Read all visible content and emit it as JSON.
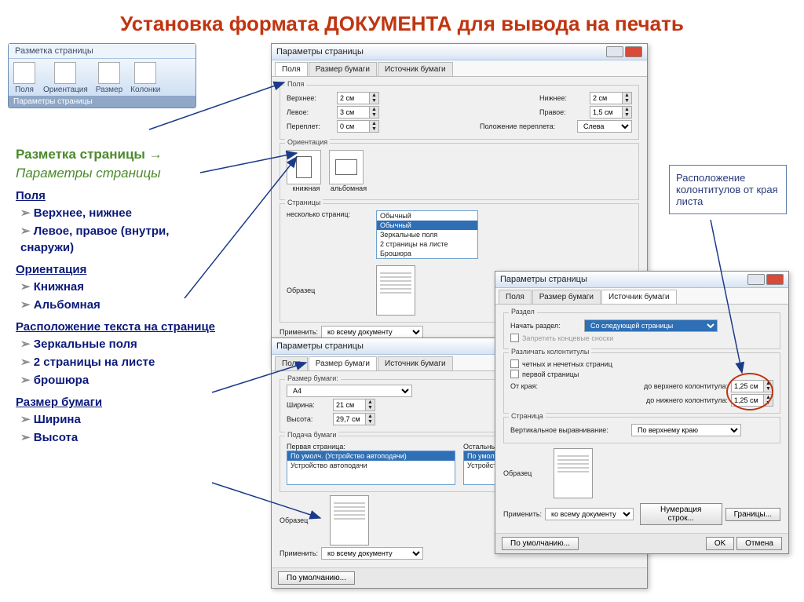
{
  "title": "Установка формата ДОКУМЕНТА для вывода на печать",
  "ribbon": {
    "tab": "Разметка страницы",
    "items": [
      "Поля",
      "Ориентация",
      "Размер",
      "Колонки"
    ],
    "footer": "Параметры страницы"
  },
  "left": {
    "path1": "Разметка страницы →",
    "path2": "Параметры страницы",
    "h_fields": "Поля",
    "fields": [
      "Верхнее, нижнее",
      "Левое, правое (внутри, снаружи)"
    ],
    "h_orient": "Ориентация",
    "orient": [
      "Книжная",
      "Альбомная"
    ],
    "h_layout": "Расположение текста на странице",
    "layout": [
      "Зеркальные поля",
      "2 страницы на листе",
      "брошюра"
    ],
    "h_size": "Размер бумаги",
    "size": [
      "Ширина",
      "Высота"
    ]
  },
  "callout": "Расположение колонтитулов от края листа",
  "dlg_common": {
    "title": "Параметры страницы",
    "tabs": [
      "Поля",
      "Размер бумаги",
      "Источник бумаги"
    ],
    "apply_lbl": "Применить:",
    "apply_val": "ко всему документу",
    "default": "По умолчанию...",
    "ok": "OK",
    "cancel": "Отмена"
  },
  "dlg1": {
    "margins": {
      "top": "2 см",
      "bottom": "2 см",
      "left": "3 см",
      "right": "1,5 см",
      "gutter": "0 см",
      "gutter_pos": "Слева"
    },
    "lbl_top": "Верхнее:",
    "lbl_bottom": "Нижнее:",
    "lbl_left": "Левое:",
    "lbl_right": "Правое:",
    "lbl_gutter": "Переплет:",
    "lbl_gpos": "Положение переплета:",
    "grp_orient": "Ориентация",
    "book": "книжная",
    "land": "альбомная",
    "grp_pages": "Страницы",
    "multi_lbl": "несколько страниц:",
    "dropdown": [
      "Обычный",
      "Обычный",
      "Зеркальные поля",
      "2 страницы на листе",
      "Брошюра"
    ],
    "grp_sample": "Образец"
  },
  "dlg2": {
    "grp_size": "Размер бумаги:",
    "paper": "A4",
    "w_lbl": "Ширина:",
    "w": "21 см",
    "h_lbl": "Высота:",
    "h": "29,7 см",
    "grp_feed": "Подача бумаги",
    "first": "Первая страница:",
    "other": "Остальные стр.",
    "feed_items": [
      "По умолч. (Устройство автоподачи)",
      "Устройство автоподачи"
    ],
    "grp_sample": "Образец"
  },
  "dlg3": {
    "grp_sec": "Раздел",
    "start_lbl": "Начать раздел:",
    "start_val": "Со следующей страницы",
    "suppress": "Запретить концевые сноски",
    "grp_hf": "Различать колонтитулы",
    "odd_even": "четных и нечетных страниц",
    "first_pg": "первой страницы",
    "edge_lbl": "От края:",
    "to_hdr": "до верхнего колонтитула:",
    "to_ftr": "до нижнего колонтитула:",
    "hdr_val": "1,25 см",
    "ftr_val": "1,25 см",
    "grp_pg": "Страница",
    "valign_lbl": "Вертикальное выравнивание:",
    "valign_val": "По верхнему краю",
    "grp_sample": "Образец",
    "lines_btn": "Нумерация строк...",
    "borders_btn": "Границы..."
  }
}
